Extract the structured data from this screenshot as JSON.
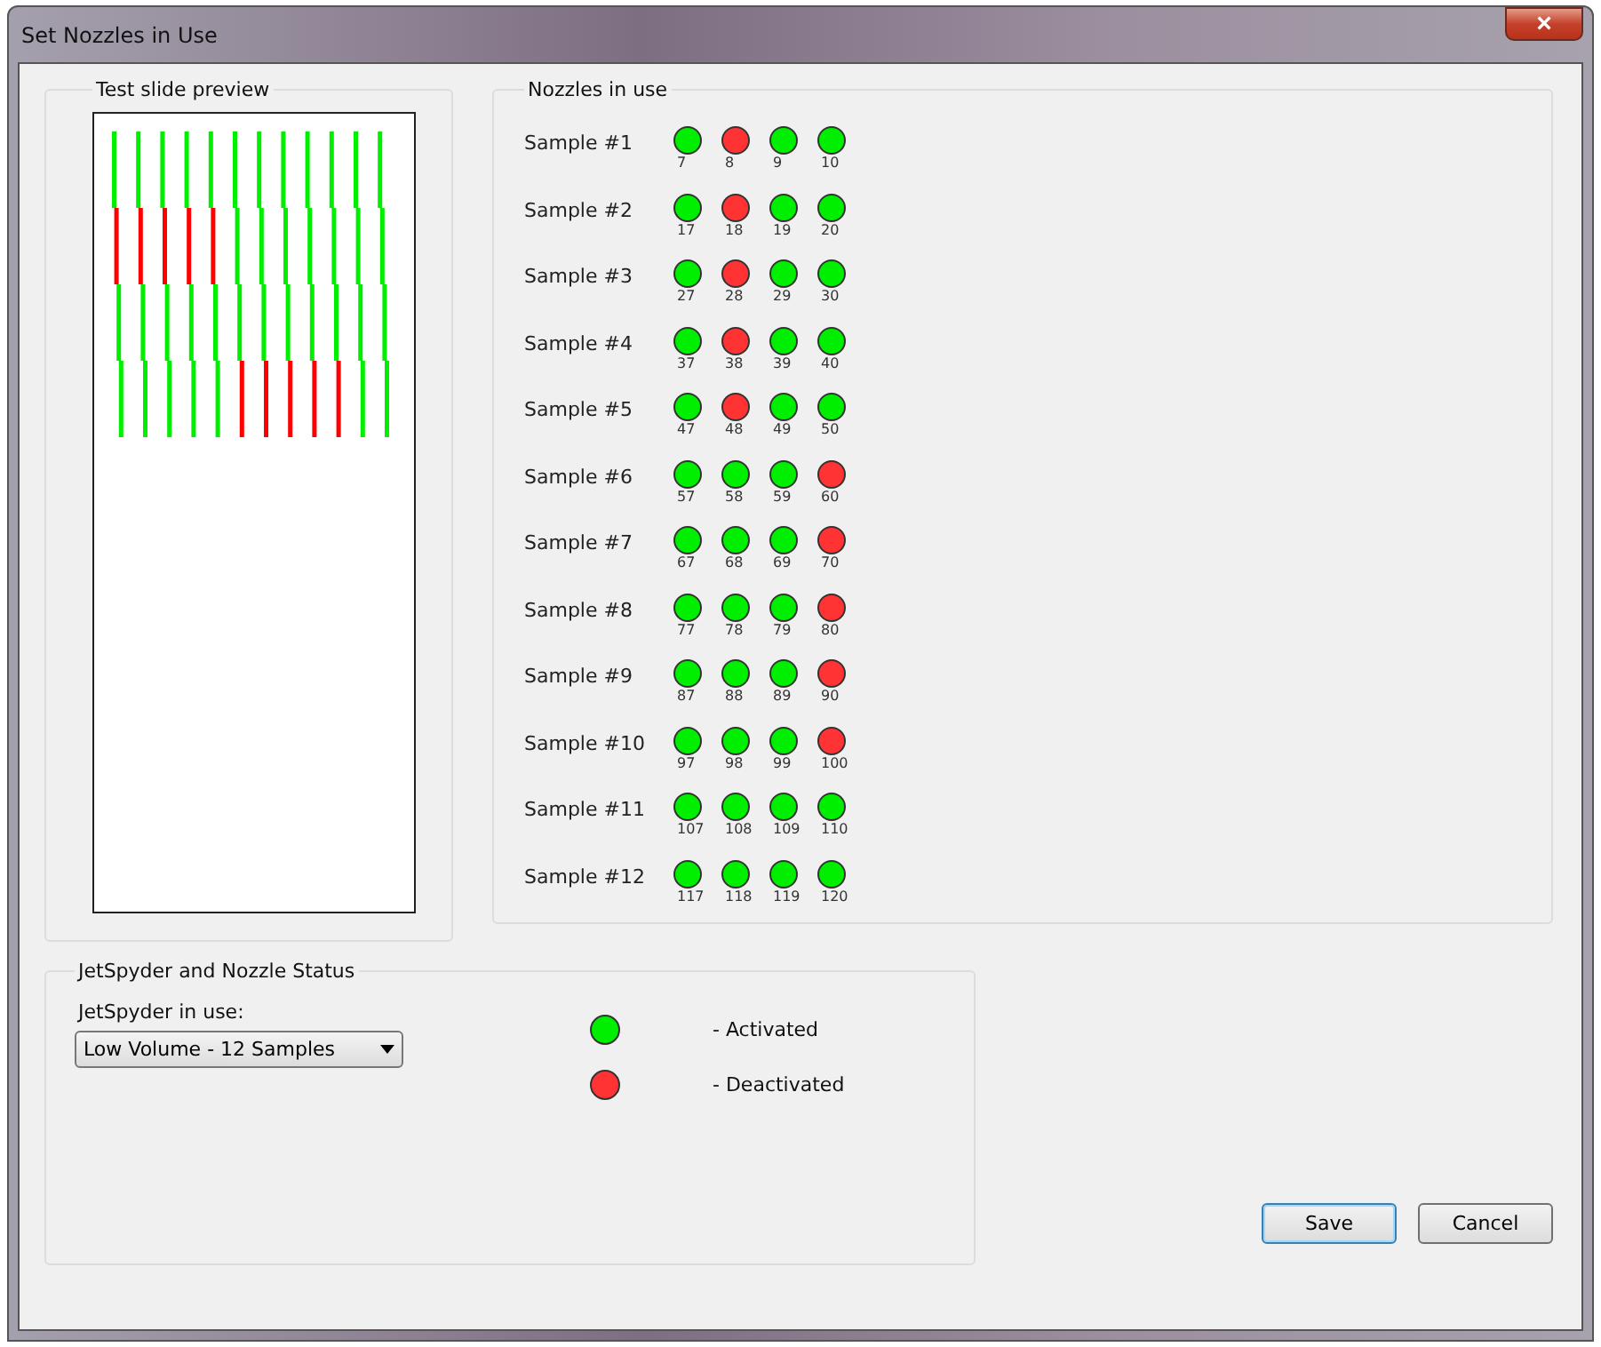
{
  "window": {
    "title": "Set Nozzles in Use",
    "close": "×"
  },
  "preview": {
    "title": "Test slide preview",
    "rows": [
      [
        true,
        true,
        true,
        true,
        true,
        true,
        true,
        true,
        true,
        true,
        true,
        true
      ],
      [
        false,
        false,
        false,
        false,
        false,
        true,
        true,
        true,
        true,
        true,
        true,
        true
      ],
      [
        true,
        true,
        true,
        true,
        true,
        true,
        true,
        true,
        true,
        true,
        true,
        true
      ],
      [
        true,
        true,
        true,
        true,
        true,
        false,
        false,
        false,
        false,
        false,
        true,
        true
      ]
    ]
  },
  "nozzles": {
    "title": "Nozzles in use",
    "samples": [
      {
        "label": "Sample #1",
        "nozzles": [
          {
            "number": "7",
            "active": true
          },
          {
            "number": "8",
            "active": false
          },
          {
            "number": "9",
            "active": true
          },
          {
            "number": "10",
            "active": true
          }
        ]
      },
      {
        "label": "Sample #2",
        "nozzles": [
          {
            "number": "17",
            "active": true
          },
          {
            "number": "18",
            "active": false
          },
          {
            "number": "19",
            "active": true
          },
          {
            "number": "20",
            "active": true
          }
        ]
      },
      {
        "label": "Sample #3",
        "nozzles": [
          {
            "number": "27",
            "active": true
          },
          {
            "number": "28",
            "active": false
          },
          {
            "number": "29",
            "active": true
          },
          {
            "number": "30",
            "active": true
          }
        ]
      },
      {
        "label": "Sample #4",
        "nozzles": [
          {
            "number": "37",
            "active": true
          },
          {
            "number": "38",
            "active": false
          },
          {
            "number": "39",
            "active": true
          },
          {
            "number": "40",
            "active": true
          }
        ]
      },
      {
        "label": "Sample #5",
        "nozzles": [
          {
            "number": "47",
            "active": true
          },
          {
            "number": "48",
            "active": false
          },
          {
            "number": "49",
            "active": true
          },
          {
            "number": "50",
            "active": true
          }
        ]
      },
      {
        "label": "Sample #6",
        "nozzles": [
          {
            "number": "57",
            "active": true
          },
          {
            "number": "58",
            "active": true
          },
          {
            "number": "59",
            "active": true
          },
          {
            "number": "60",
            "active": false
          }
        ]
      },
      {
        "label": "Sample #7",
        "nozzles": [
          {
            "number": "67",
            "active": true
          },
          {
            "number": "68",
            "active": true
          },
          {
            "number": "69",
            "active": true
          },
          {
            "number": "70",
            "active": false
          }
        ]
      },
      {
        "label": "Sample #8",
        "nozzles": [
          {
            "number": "77",
            "active": true
          },
          {
            "number": "78",
            "active": true
          },
          {
            "number": "79",
            "active": true
          },
          {
            "number": "80",
            "active": false
          }
        ]
      },
      {
        "label": "Sample #9",
        "nozzles": [
          {
            "number": "87",
            "active": true
          },
          {
            "number": "88",
            "active": true
          },
          {
            "number": "89",
            "active": true
          },
          {
            "number": "90",
            "active": false
          }
        ]
      },
      {
        "label": "Sample #10",
        "nozzles": [
          {
            "number": "97",
            "active": true
          },
          {
            "number": "98",
            "active": true
          },
          {
            "number": "99",
            "active": true
          },
          {
            "number": "100",
            "active": false
          }
        ]
      },
      {
        "label": "Sample #11",
        "nozzles": [
          {
            "number": "107",
            "active": true
          },
          {
            "number": "108",
            "active": true
          },
          {
            "number": "109",
            "active": true
          },
          {
            "number": "110",
            "active": true
          }
        ]
      },
      {
        "label": "Sample #12",
        "nozzles": [
          {
            "number": "117",
            "active": true
          },
          {
            "number": "118",
            "active": true
          },
          {
            "number": "119",
            "active": true
          },
          {
            "number": "120",
            "active": true
          }
        ]
      }
    ]
  },
  "status": {
    "title": "JetSpyder and Nozzle Status",
    "field_label": "JetSpyder in use:",
    "dropdown_value": "Low Volume - 12 Samples",
    "legend": [
      {
        "active": true,
        "label": "- Activated"
      },
      {
        "active": false,
        "label": "- Deactivated"
      }
    ]
  },
  "buttons": [
    {
      "label": "Save",
      "default": true
    },
    {
      "label": "Cancel",
      "default": false
    }
  ]
}
